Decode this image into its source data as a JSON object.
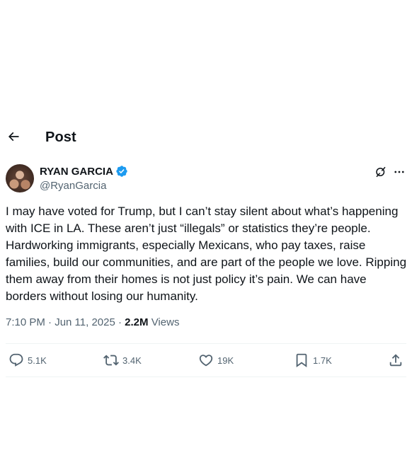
{
  "header": {
    "title": "Post",
    "back_icon": "arrow-left-icon"
  },
  "author": {
    "display_name": "RYAN GARCIA",
    "handle": "@RyanGarcia",
    "verified_icon": "verified-badge-icon",
    "verified_color": "#1d9bf0"
  },
  "post": {
    "text": "I may have voted for Trump, but I can’t stay silent about what’s happening with ICE in LA. These aren’t just “illegals” or statistics they’re people. Hardworking immigrants, especially Mexicans, who pay taxes, raise families, build our communities, and are part of the people we love. Ripping them away from their homes is not just policy it’s pain. We can have borders without losing our humanity.",
    "time": "7:10 PM · Jun 11, 2025",
    "separator": " · ",
    "views_count": "2.2M",
    "views_label": " Views"
  },
  "actions": {
    "replies": "5.1K",
    "reposts": "3.4K",
    "likes": "19K",
    "bookmarks": "1.7K"
  },
  "colors": {
    "text": "#0f1419",
    "secondary": "#536471",
    "divider": "#eff3f4"
  }
}
